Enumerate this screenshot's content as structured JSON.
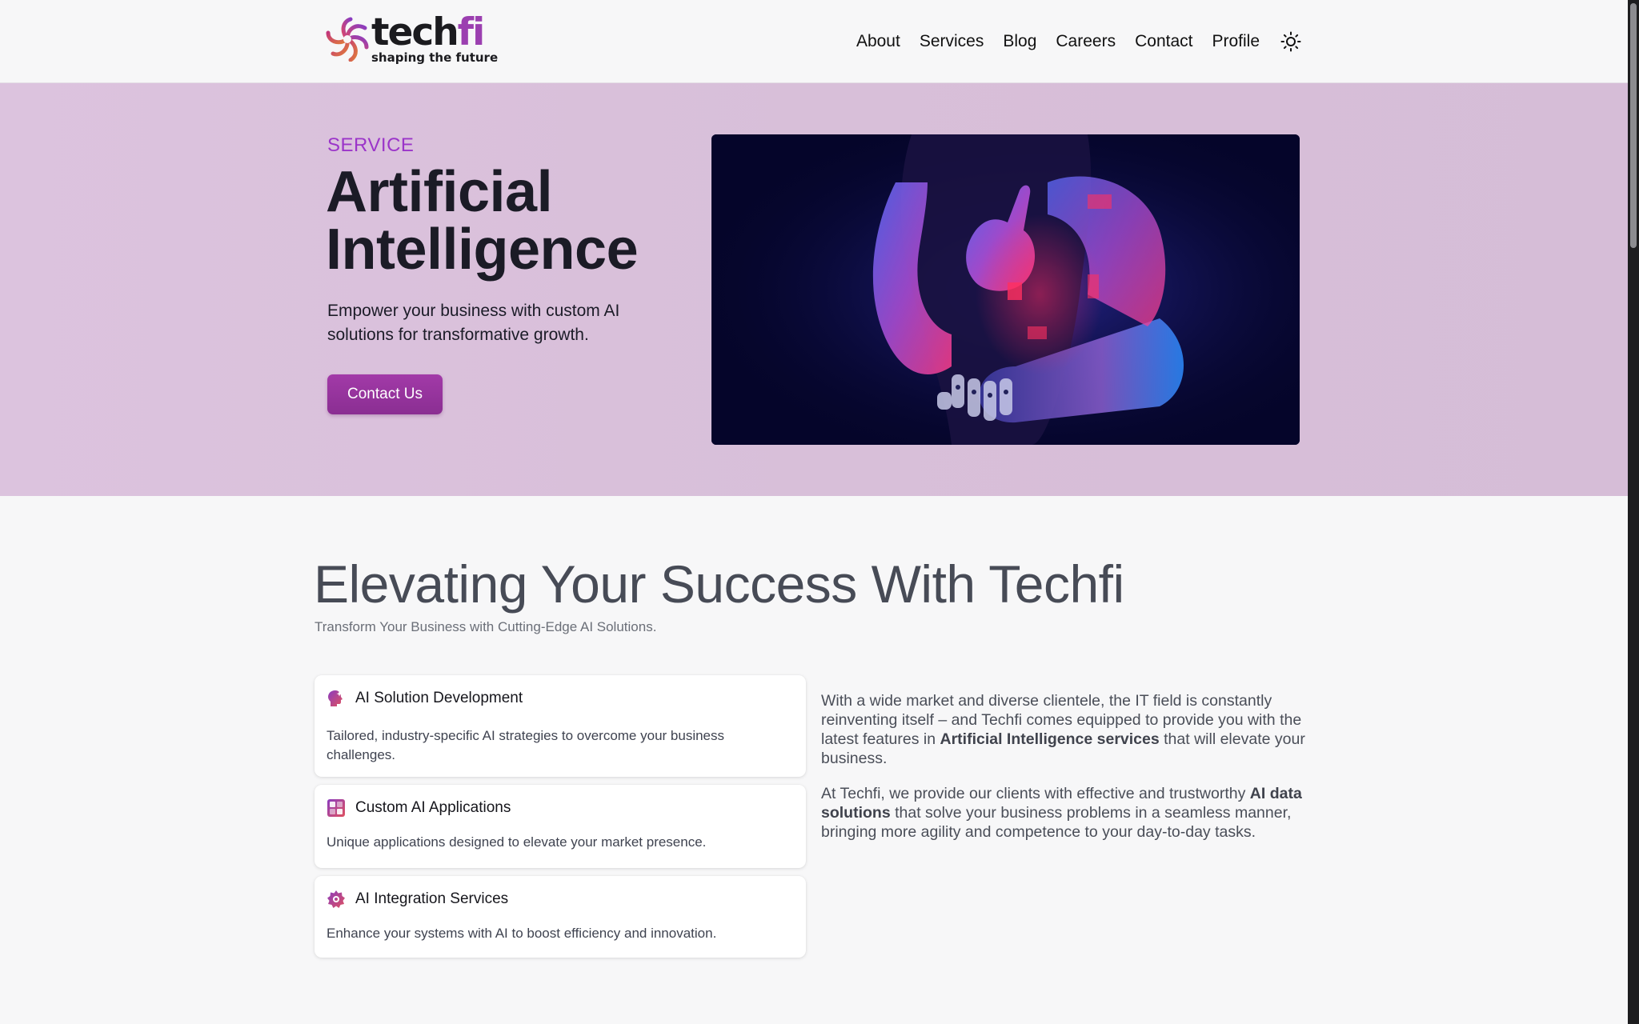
{
  "brand": {
    "name_main": "tech",
    "name_accent": "fi",
    "tagline": "shaping the future",
    "primary_color": "#9b3fb0"
  },
  "nav": {
    "items": [
      "About",
      "Services",
      "Blog",
      "Careers",
      "Contact",
      "Profile"
    ],
    "theme_toggle_icon": "sun-icon"
  },
  "hero": {
    "eyebrow": "SERVICE",
    "title": "Artificial Intelligence",
    "description": "Empower your business with custom AI solutions for transformative growth.",
    "cta_label": "Contact Us",
    "background_color": "#d9c0da",
    "cta_color": "#952f9c"
  },
  "section": {
    "title": "Elevating Your Success With Techfi",
    "subtitle": "Transform Your Business with Cutting-Edge AI Solutions.",
    "cards": [
      {
        "icon": "ai-head-icon",
        "title": "AI Solution Development",
        "description": "Tailored, industry-specific AI strategies to overcome your business challenges."
      },
      {
        "icon": "app-blocks-icon",
        "title": "Custom AI Applications",
        "description": "Unique applications designed to elevate your market presence."
      },
      {
        "icon": "integration-gear-icon",
        "title": "AI Integration Services",
        "description": "Enhance your systems with AI to boost efficiency and innovation."
      }
    ],
    "paragraph1": {
      "before": "With a wide market and diverse clientele, the IT field is constantly reinventing itself – and Techfi comes equipped to provide you with the latest features in ",
      "bold": "Artificial Intelligence services",
      "after": " that will elevate your business."
    },
    "paragraph2": {
      "before": "At Techfi, we provide our clients with effective and trustworthy ",
      "bold": "AI data solutions",
      "after": " that solve your business problems in a seamless manner, bringing more agility and competence to your day-to-day tasks."
    }
  }
}
